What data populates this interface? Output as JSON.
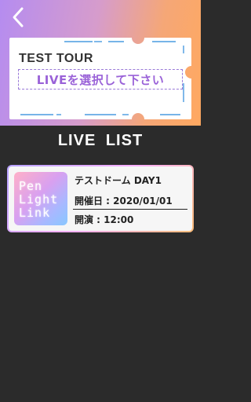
{
  "header": {
    "tour_title": "TEST TOUR",
    "instruction": "LIVEを選択して下さい"
  },
  "list": {
    "title": "LIVE  LIST",
    "items": [
      {
        "logo_lines": [
          "Pen",
          "Light",
          "Link"
        ],
        "name": "テストドーム DAY1",
        "date_label": "開催日 : ",
        "date": "2020/01/01",
        "time_label": "開演 : ",
        "time": "12:00"
      }
    ]
  },
  "colors": {
    "background": "#2b2b2b",
    "header_gradient_start": "#b58cf0",
    "header_gradient_end": "#ffa860",
    "accent_purple": "#9a62d8",
    "accent_blue": "#4a9be0"
  },
  "icons": {
    "back": "chevron-left-icon"
  }
}
